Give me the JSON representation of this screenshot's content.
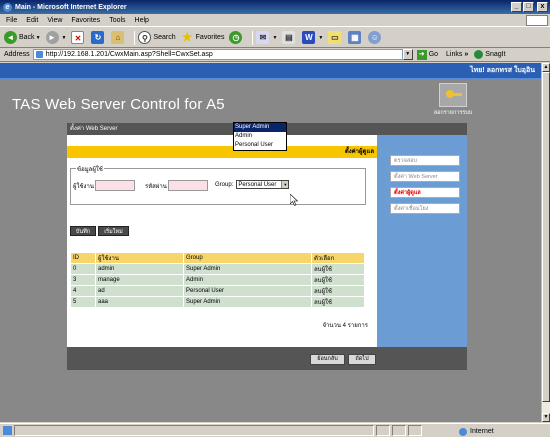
{
  "window": {
    "title": "Main - Microsoft Internet Explorer",
    "buttons": [
      "_",
      "□",
      "x"
    ]
  },
  "menu": [
    "File",
    "Edit",
    "View",
    "Favorites",
    "Tools",
    "Help"
  ],
  "toolbar": {
    "back": "Back",
    "search": "Search",
    "favorites": "Favorites"
  },
  "address": {
    "label": "Address",
    "url": "http://192.168.1.201/CwxMain.asp?Shell=CwxSet.asp",
    "go": "Go",
    "links": "Links",
    "snagit": "SnagIt"
  },
  "page": {
    "user_bar": "ไทย! ลอกทรส ใบอุอิน",
    "title": "TAS Web Server Control for A5",
    "logout_label": "ลอกรายการรบบ"
  },
  "panel": {
    "header": "ตั้งค่า Web Server",
    "section_title": "ตั้งค่าผู้ดูแล",
    "legend": "ข้อมูลผู้ใช้",
    "username_label": "ผู้ใช้งาน",
    "password_label": "รหัสผ่าน",
    "group_label": "Group:",
    "group_value": "Personal User",
    "group_options": [
      "Super Admin",
      "Admin",
      "Personal User"
    ],
    "group_selected_option": "Super Admin",
    "save_btn": "บันทึก",
    "new_btn": "เริ่มใหม่",
    "table_headers": [
      "ID",
      "ผู้ใช้งาน",
      "Group",
      "ตัวเลือก"
    ],
    "rows": [
      [
        "0",
        "admin",
        "Super Admin",
        "ลบผู้ใช้"
      ],
      [
        "3",
        "manage",
        "Admin",
        "ลบผู้ใช้"
      ],
      [
        "4",
        "ad",
        "Personal User",
        "ลบผู้ใช้"
      ],
      [
        "5",
        "aaa",
        "Super Admin",
        "ลบผู้ใช้"
      ]
    ],
    "count_text": "จำนวน 4 รายการ",
    "back_btn": "ย้อนกลับ",
    "next_btn": "ถัดไป"
  },
  "sidebar": {
    "items": [
      {
        "label": "ตรวจสอบ",
        "active": false
      },
      {
        "label": "ตั้งค่า Web Server",
        "active": false
      },
      {
        "label": "ตั้งค่าผู้ดูแล",
        "active": true
      },
      {
        "label": "ตั้งค่าเชื่อมโยง",
        "active": false
      }
    ]
  },
  "status": {
    "zone": "Internet"
  },
  "colors": {
    "blue_bar": "#2b5fb4",
    "yellow_bar": "#f7c600",
    "sidebar": "#6c9cd4",
    "row_bg": "#cfe0cf"
  }
}
